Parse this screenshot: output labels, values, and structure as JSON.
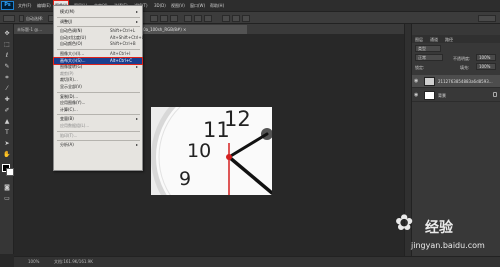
{
  "app": {
    "logo": "Ps"
  },
  "menubar": [
    {
      "label": "文件(F)",
      "active": false
    },
    {
      "label": "编辑(E)",
      "active": false
    },
    {
      "label": "图像(I)",
      "active": true
    },
    {
      "label": "图层(L)",
      "active": false
    },
    {
      "label": "文字(Y)",
      "active": false
    },
    {
      "label": "选择(S)",
      "active": false
    },
    {
      "label": "滤镜(T)",
      "active": false
    },
    {
      "label": "3D(D)",
      "active": false
    },
    {
      "label": "视图(V)",
      "active": false
    },
    {
      "label": "窗口(W)",
      "active": false
    },
    {
      "label": "帮助(H)",
      "active": false
    }
  ],
  "options": {
    "auto_select": "自动选择:"
  },
  "tabs": [
    {
      "label": "未标题-1 @...",
      "active": false
    },
    {
      "label": "...jpg@1280x_0_0a_100sh_RGB/8#) ×",
      "active": true
    }
  ],
  "image_menu": [
    {
      "label": "模式(M)",
      "shortcut": "",
      "arrow": true,
      "disabled": false,
      "highlight": false
    },
    {
      "sep": true
    },
    {
      "label": "调整(J)",
      "shortcut": "",
      "arrow": true,
      "disabled": false,
      "highlight": false
    },
    {
      "sep": true
    },
    {
      "label": "自动色调(N)",
      "shortcut": "Shift+Ctrl+L",
      "arrow": false,
      "disabled": false,
      "highlight": false
    },
    {
      "label": "自动对比度(U)",
      "shortcut": "Alt+Shift+Ctrl+L",
      "arrow": false,
      "disabled": false,
      "highlight": false
    },
    {
      "label": "自动颜色(O)",
      "shortcut": "Shift+Ctrl+B",
      "arrow": false,
      "disabled": false,
      "highlight": false
    },
    {
      "sep": true
    },
    {
      "label": "图像大小(I)...",
      "shortcut": "Alt+Ctrl+I",
      "arrow": false,
      "disabled": false,
      "highlight": false
    },
    {
      "label": "画布大小(S)...",
      "shortcut": "Alt+Ctrl+C",
      "arrow": false,
      "disabled": false,
      "highlight": true
    },
    {
      "label": "图像旋转(G)",
      "shortcut": "",
      "arrow": true,
      "disabled": false,
      "highlight": false
    },
    {
      "label": "裁剪(P)",
      "shortcut": "",
      "arrow": false,
      "disabled": true,
      "highlight": false
    },
    {
      "label": "裁切(R)...",
      "shortcut": "",
      "arrow": false,
      "disabled": false,
      "highlight": false
    },
    {
      "label": "显示全部(V)",
      "shortcut": "",
      "arrow": false,
      "disabled": false,
      "highlight": false
    },
    {
      "sep": true
    },
    {
      "label": "复制(D)...",
      "shortcut": "",
      "arrow": false,
      "disabled": false,
      "highlight": false
    },
    {
      "label": "应用图像(Y)...",
      "shortcut": "",
      "arrow": false,
      "disabled": false,
      "highlight": false
    },
    {
      "label": "计算(C)...",
      "shortcut": "",
      "arrow": false,
      "disabled": false,
      "highlight": false
    },
    {
      "sep": true
    },
    {
      "label": "变量(B)",
      "shortcut": "",
      "arrow": true,
      "disabled": false,
      "highlight": false
    },
    {
      "label": "应用数据组(L)...",
      "shortcut": "",
      "arrow": false,
      "disabled": true,
      "highlight": false
    },
    {
      "sep": true
    },
    {
      "label": "陷印(T)...",
      "shortcut": "",
      "arrow": false,
      "disabled": true,
      "highlight": false
    },
    {
      "sep": true
    },
    {
      "label": "分析(A)",
      "shortcut": "",
      "arrow": true,
      "disabled": false,
      "highlight": false
    }
  ],
  "layers_panel": {
    "tabs": [
      "图层",
      "通道",
      "路径"
    ],
    "kind": "类型",
    "blend_mode": "正常",
    "opacity_label": "不透明度:",
    "opacity": "100%",
    "lock_label": "锁定:",
    "fill_label": "填充:",
    "fill": "100%",
    "layers": [
      {
        "name": "2112763854883a6d8593...",
        "selected": true,
        "locked": false
      },
      {
        "name": "背景",
        "selected": false,
        "locked": true
      }
    ]
  },
  "status": {
    "zoom": "100%",
    "doc": "文档:161.9K/161.9K"
  },
  "watermark": {
    "brand": "Bai百度",
    "product": "经验",
    "url": "jingyan.baidu.com"
  },
  "colors": {
    "highlight": "#1b3f8f",
    "annotation": "#e0231b",
    "clock_hand": "#d42020"
  }
}
